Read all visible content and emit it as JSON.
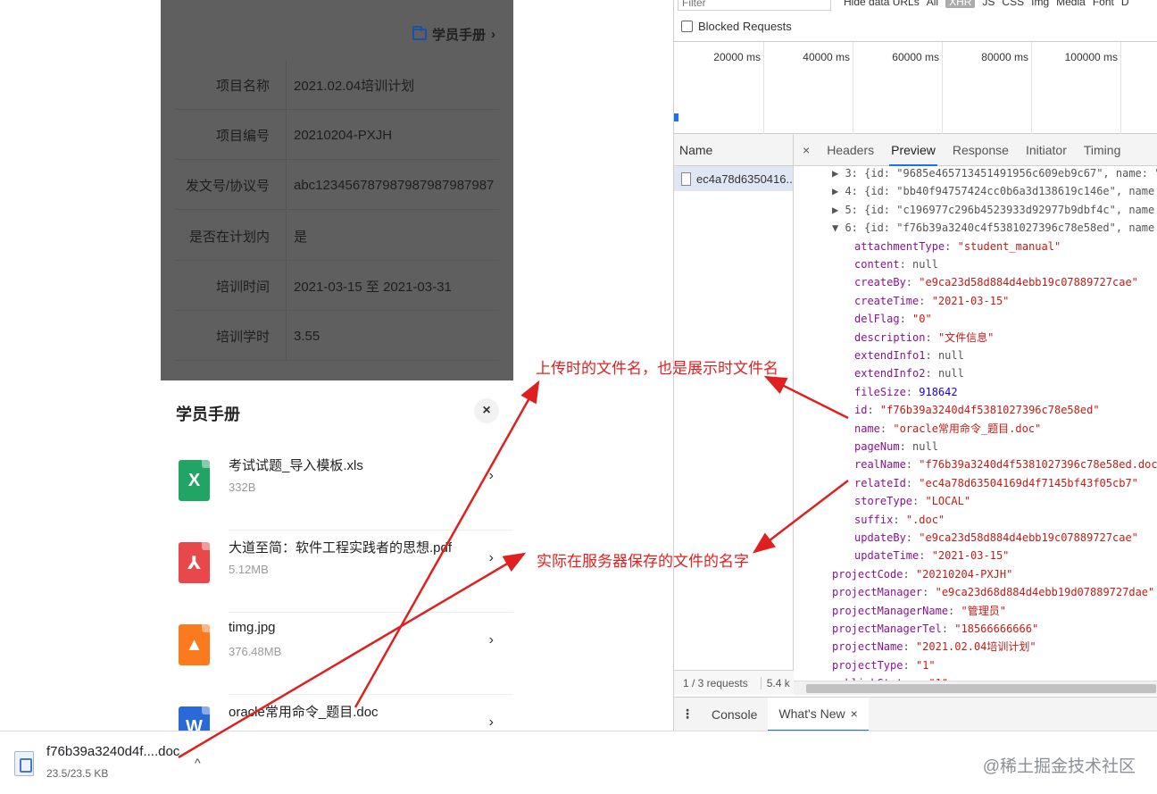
{
  "mobile": {
    "manual_link": "学员手册",
    "info_rows": [
      {
        "label": "项目名称",
        "value": "2021.02.04培训计划"
      },
      {
        "label": "项目编号",
        "value": "20210204-PXJH"
      },
      {
        "label": "发文号/协议号",
        "value": "abc12345678798798798798798​7"
      },
      {
        "label": "是否在计划内",
        "value": "是"
      },
      {
        "label": "培训时间",
        "value": "2021-03-15 至 2021-03-31"
      },
      {
        "label": "培训学时",
        "value": "3.55"
      }
    ],
    "sheet": {
      "title": "学员手册",
      "close_icon": "close-icon",
      "files": [
        {
          "name": "考试试题_导入模板.xls",
          "size": "332B",
          "type": "xls",
          "glyph": "X",
          "color": "#21a464"
        },
        {
          "name": "大道至简：软件工程实践者的思想.pdf",
          "size": "5.12MB",
          "type": "pdf",
          "glyph": "⅄",
          "color": "#e9484b"
        },
        {
          "name": "timg.jpg",
          "size": "376.48MB",
          "type": "img",
          "glyph": "▲",
          "color": "#fb7a1e"
        },
        {
          "name": "oracle常用命令_题目.doc",
          "size": "",
          "type": "doc",
          "glyph": "W",
          "color": "#2a6ad8"
        }
      ]
    }
  },
  "download": {
    "filename": "f76b39a3240d4f....doc",
    "progress": "23.5/23.5 KB",
    "caret": "^"
  },
  "watermark": "@稀土掘金技术社区",
  "devtools": {
    "filter_placeholder": "Filter",
    "filter_types": [
      "Hide data URLs",
      "All",
      "XHR",
      "JS",
      "CSS",
      "Img",
      "Media",
      "Font",
      "D"
    ],
    "blocked_requests": "Blocked Requests",
    "timeline_ticks": [
      "20000 ms",
      "40000 ms",
      "60000 ms",
      "80000 ms",
      "100000 ms",
      "1"
    ],
    "name_header": "Name",
    "request_name": "ec4a78d6350416...",
    "tabs": [
      "×",
      "Headers",
      "Preview",
      "Response",
      "Initiator",
      "Timing"
    ],
    "active_tab": "Preview",
    "status_requests": "1 / 3 requests",
    "status_size": "5.4 k",
    "drawer_tabs": [
      "Console",
      "What's New"
    ],
    "json_lines": [
      {
        "prefix": "▶ 3: ",
        "text": "{id: \"9685e465713451491956c609eb9c67\", name: \"",
        "indent": 1
      },
      {
        "prefix": "▶ 4: ",
        "text": "{id: \"bb40f94757424cc0b6a3d138619c146e\", name: \"",
        "indent": 1
      },
      {
        "prefix": "▶ 5: ",
        "text": "{id: \"c196977c296b4523933d92977b9dbf4c\", name: \"",
        "indent": 1
      },
      {
        "prefix": "▼ 6: ",
        "text": "{id: \"f76b39a3240c4f5381027396c78e58ed\", name: \"",
        "indent": 1
      },
      {
        "key": "attachmentType",
        "value": "\"student_manual\"",
        "kind": "str",
        "indent": 2
      },
      {
        "key": "content",
        "value": "null",
        "kind": "null",
        "indent": 2
      },
      {
        "key": "createBy",
        "value": "\"e9ca23d58d884d4ebb19c07889727cae\"",
        "kind": "str",
        "indent": 2
      },
      {
        "key": "createTime",
        "value": "\"2021-03-15\"",
        "kind": "str",
        "indent": 2
      },
      {
        "key": "delFlag",
        "value": "\"0\"",
        "kind": "str",
        "indent": 2
      },
      {
        "key": "description",
        "value": "\"文件信息\"",
        "kind": "str",
        "indent": 2
      },
      {
        "key": "extendInfo1",
        "value": "null",
        "kind": "null",
        "indent": 2
      },
      {
        "key": "extendInfo2",
        "value": "null",
        "kind": "null",
        "indent": 2
      },
      {
        "key": "fileSize",
        "value": "918642",
        "kind": "num",
        "indent": 2
      },
      {
        "key": "id",
        "value": "\"f76b39a3240d4f5381027396c78e58ed\"",
        "kind": "str",
        "indent": 2
      },
      {
        "key": "name",
        "value": "\"oracle常用命令_题目.doc\"",
        "kind": "str",
        "indent": 2
      },
      {
        "key": "pageNum",
        "value": "null",
        "kind": "null",
        "indent": 2
      },
      {
        "key": "realName",
        "value": "\"f76b39a3240d4f5381027396c78e58ed.doc\"",
        "kind": "str",
        "indent": 2
      },
      {
        "key": "relateId",
        "value": "\"ec4a78d63504169d4f7145bf43f05cb7\"",
        "kind": "str",
        "indent": 2
      },
      {
        "key": "storeType",
        "value": "\"LOCAL\"",
        "kind": "str",
        "indent": 2
      },
      {
        "key": "suffix",
        "value": "\".doc\"",
        "kind": "str",
        "indent": 2
      },
      {
        "key": "updateBy",
        "value": "\"e9ca23d58d884d4ebb19c07889727cae\"",
        "kind": "str",
        "indent": 2
      },
      {
        "key": "updateTime",
        "value": "\"2021-03-15\"",
        "kind": "str",
        "indent": 2
      },
      {
        "key": "projectCode",
        "value": "\"20210204-PXJH\"",
        "kind": "str",
        "indent": 0
      },
      {
        "key": "projectManager",
        "value": "\"e9ca23d68d884d4ebb19d07889727dae\"",
        "kind": "str",
        "indent": 0
      },
      {
        "key": "projectManagerName",
        "value": "\"管理员\"",
        "kind": "str",
        "indent": 0
      },
      {
        "key": "projectManagerTel",
        "value": "\"18566666666\"",
        "kind": "str",
        "indent": 0
      },
      {
        "key": "projectName",
        "value": "\"2021.02.04培训计划\"",
        "kind": "str",
        "indent": 0
      },
      {
        "key": "projectType",
        "value": "\"1\"",
        "kind": "str",
        "indent": 0
      },
      {
        "key": "publishStatus",
        "value": "\"1\"",
        "kind": "str",
        "indent": 0
      }
    ]
  },
  "annotations": {
    "upload_name": "上传时的文件名，也是展示时文件名",
    "server_name": "实际在服务器保存的文件的名字",
    "color": "#e02020"
  }
}
